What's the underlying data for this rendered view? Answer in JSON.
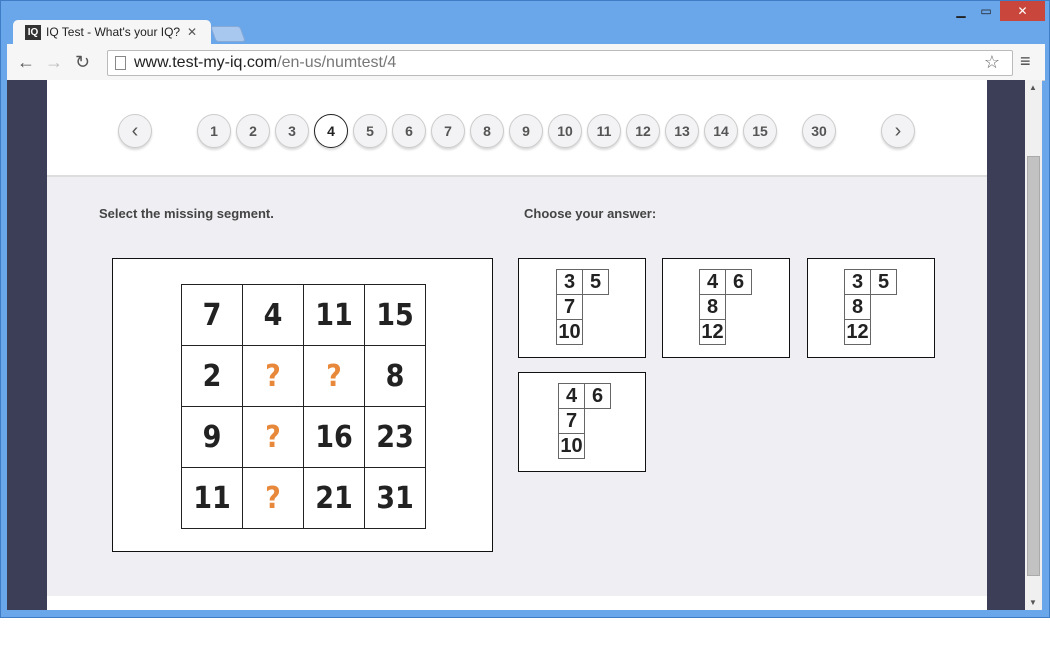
{
  "browser": {
    "tab_title": "IQ Test - What's your IQ?",
    "tab_logo": "IQ",
    "url_host": "www.test-my-iq.com",
    "url_path": "/en-us/numtest/4"
  },
  "pager": {
    "prev_icon": "‹",
    "next_icon": "›",
    "pages": [
      "1",
      "2",
      "3",
      "4",
      "5",
      "6",
      "7",
      "8",
      "9",
      "10",
      "11",
      "12",
      "13",
      "14",
      "15"
    ],
    "last": "30",
    "current": "4"
  },
  "question": {
    "prompt": "Select the missing segment.",
    "answer_prompt": "Choose your answer:",
    "grid": [
      [
        "7",
        "4",
        "11",
        "15"
      ],
      [
        "2",
        "?",
        "?",
        "8"
      ],
      [
        "9",
        "?",
        "16",
        "23"
      ],
      [
        "11",
        "?",
        "21",
        "31"
      ]
    ]
  },
  "answers": [
    {
      "top": [
        "3",
        "5"
      ],
      "mid": "7",
      "bot": "10"
    },
    {
      "top": [
        "4",
        "6"
      ],
      "mid": "8",
      "bot": "12"
    },
    {
      "top": [
        "3",
        "5"
      ],
      "mid": "8",
      "bot": "12"
    },
    {
      "top": [
        "4",
        "6"
      ],
      "mid": "7",
      "bot": "10"
    }
  ]
}
